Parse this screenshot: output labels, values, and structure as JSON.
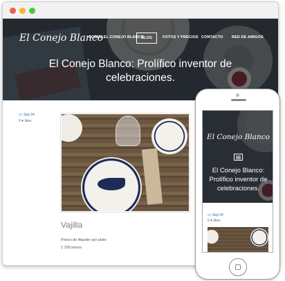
{
  "site": {
    "logo": "El Conejo Blanco",
    "nav": [
      {
        "label": "SOBRE EL CONEJO BLANCO",
        "active": false
      },
      {
        "label": "BLOG",
        "active": true
      },
      {
        "label": "FOTOS Y PRECIOS",
        "active": false
      },
      {
        "label": "CONTACTO",
        "active": false
      },
      {
        "label": "RED DE AMIGOS",
        "active": false
      }
    ],
    "hero_title": "El Conejo Blanco: Prolífico inventor de celebraciones."
  },
  "post": {
    "on": "on",
    "date": "Sep 24",
    "likes": "0 ",
    "likes_icon": "heart-icon",
    "likes_label": "likes",
    "title": "Vajilla",
    "line1": "Precio de Alquiler por plato",
    "line2": "1 100 pesos"
  },
  "phone": {
    "logo": "El Conejo Blanco",
    "hero_title": "El Conejo Blanco: Prolífico inventor de celebraciones.",
    "on": "on",
    "date": "Sep 24",
    "likes": "0 ",
    "likes_label": "likes"
  },
  "colors": {
    "dot_red": "#f15d53",
    "dot_yellow": "#f7b52c",
    "dot_green": "#4fc541",
    "link": "#2b6cb0"
  }
}
